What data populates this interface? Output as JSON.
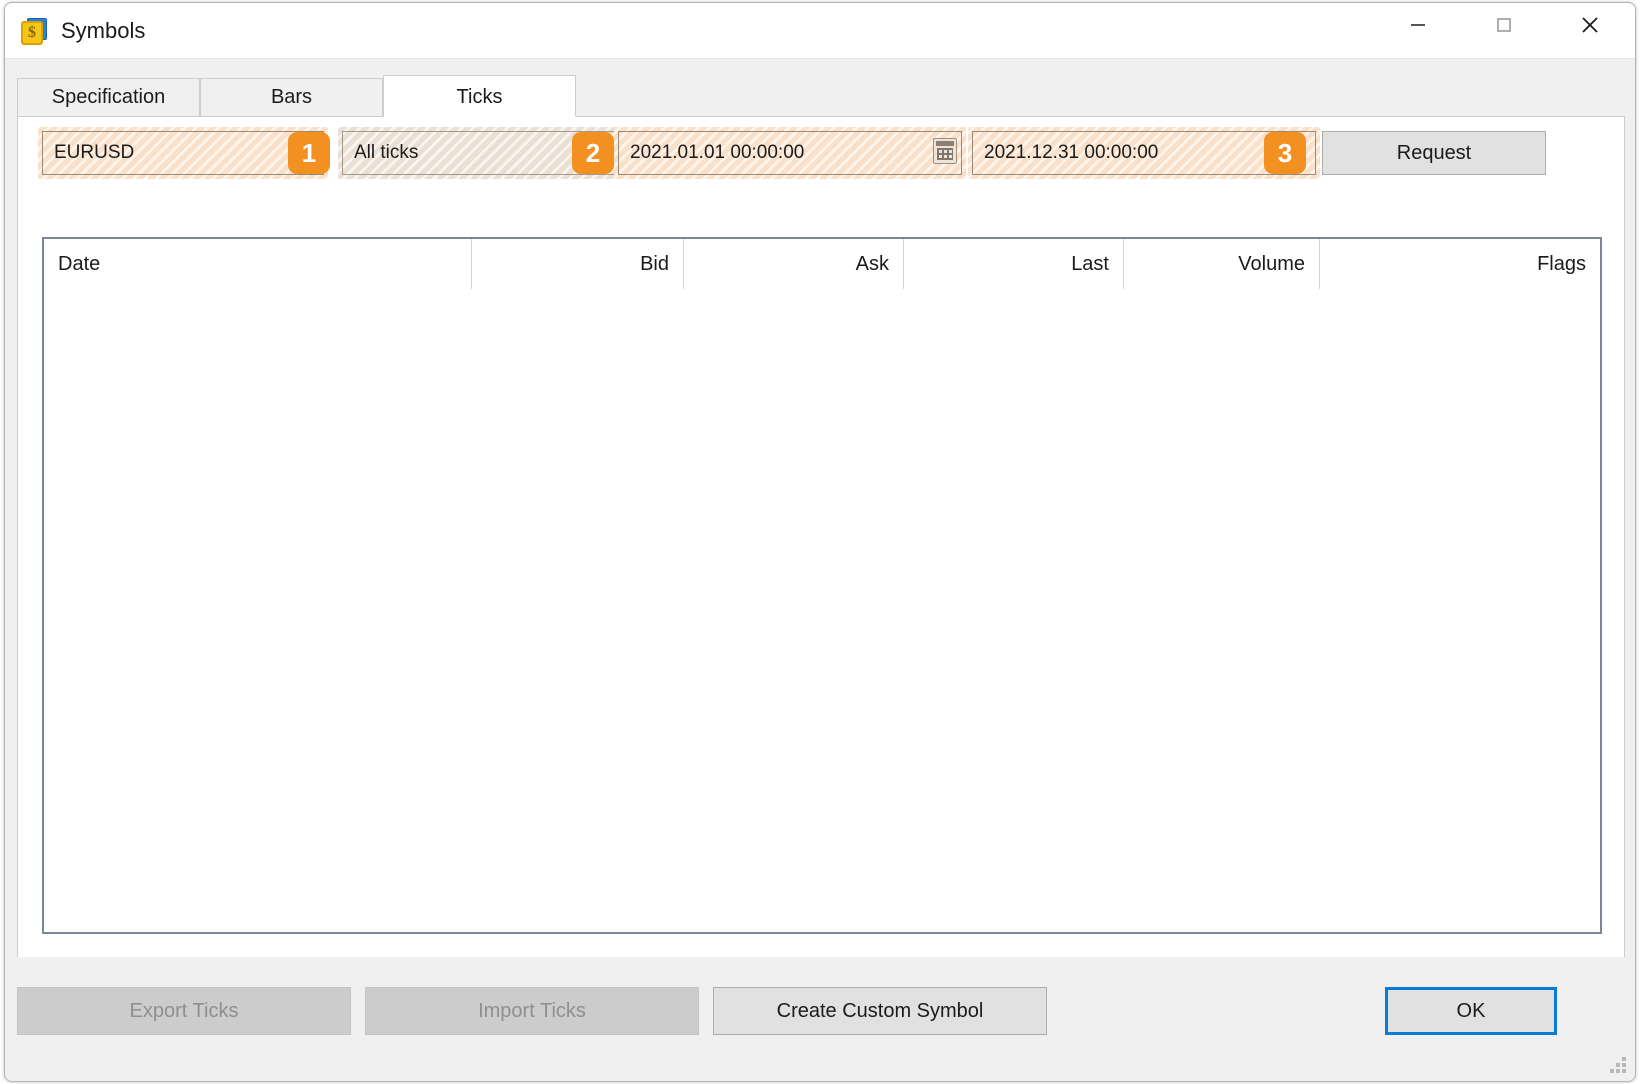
{
  "window": {
    "title": "Symbols",
    "icon": "symbols-dollar-icon",
    "controls": {
      "minimize": "minimize-icon",
      "maximize": "maximize-icon",
      "close": "close-icon"
    }
  },
  "tabs": [
    {
      "label": "Specification",
      "active": false
    },
    {
      "label": "Bars",
      "active": false
    },
    {
      "label": "Ticks",
      "active": true
    }
  ],
  "toolbar": {
    "symbol": {
      "value": "EURUSD",
      "badge": "1"
    },
    "tick_mode": {
      "value": "All ticks",
      "badge": "2"
    },
    "date_from": {
      "value": "2021.01.01 00:00:00",
      "icon": "calendar-icon"
    },
    "date_to": {
      "value": "2021.12.31 00:00:00",
      "badge": "3"
    },
    "request_label": "Request"
  },
  "table": {
    "columns": [
      {
        "label": "Date",
        "align": "left"
      },
      {
        "label": "Bid",
        "align": "right"
      },
      {
        "label": "Ask",
        "align": "right"
      },
      {
        "label": "Last",
        "align": "right"
      },
      {
        "label": "Volume",
        "align": "right"
      },
      {
        "label": "Flags",
        "align": "right"
      }
    ],
    "rows": []
  },
  "footer": {
    "export_ticks": "Export Ticks",
    "import_ticks": "Import Ticks",
    "create_custom_symbol": "Create Custom Symbol",
    "ok": "OK"
  },
  "colors": {
    "badge_orange": "#f29121",
    "highlight_peach": "#fae0c8",
    "highlight_beige": "#eadfd2",
    "focus_blue": "#0a7cd4"
  }
}
